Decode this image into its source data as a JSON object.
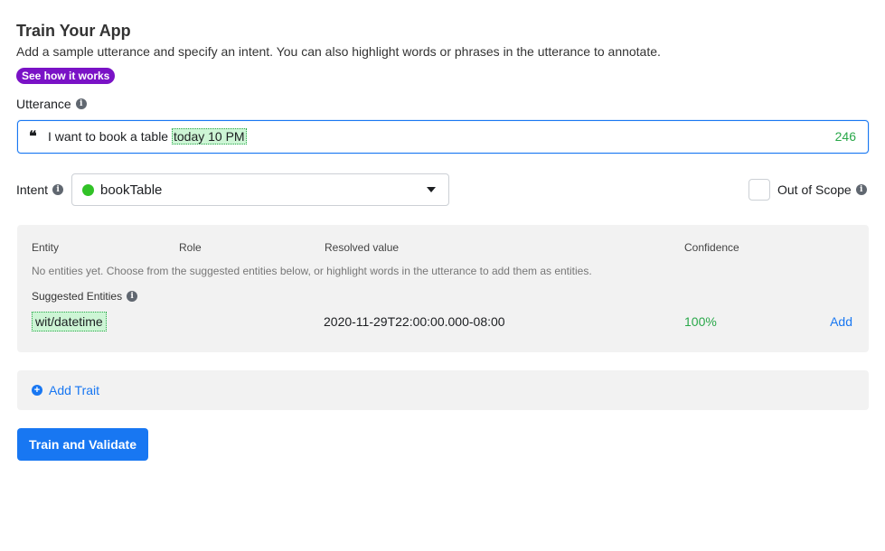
{
  "header": {
    "title": "Train Your App",
    "subtitle": "Add a sample utterance and specify an intent. You can also highlight words or phrases in the utterance to annotate.",
    "how_it_works": "See how it works"
  },
  "utterance": {
    "label": "Utterance",
    "text_plain": "I want to book a table ",
    "text_highlighted": "today 10 PM",
    "char_count": "246"
  },
  "intent": {
    "label": "Intent",
    "value": "bookTable",
    "dot_color": "#31c227"
  },
  "out_of_scope": {
    "label": "Out of Scope",
    "checked": false
  },
  "entities": {
    "columns": {
      "entity": "Entity",
      "role": "Role",
      "resolved": "Resolved value",
      "confidence": "Confidence"
    },
    "empty_message": "No entities yet. Choose from the suggested entities below, or highlight words in the utterance to add them as entities.",
    "suggested_label": "Suggested Entities",
    "suggested": [
      {
        "name": "wit/datetime",
        "resolved": "2020-11-29T22:00:00.000-08:00",
        "confidence": "100%",
        "action": "Add"
      }
    ]
  },
  "trait": {
    "add_label": "Add Trait"
  },
  "actions": {
    "train_label": "Train and Validate"
  },
  "colors": {
    "accent": "#1877f2",
    "badge": "#7a12c6",
    "highlight": "#cdf5d5",
    "success": "#2aa84a"
  }
}
